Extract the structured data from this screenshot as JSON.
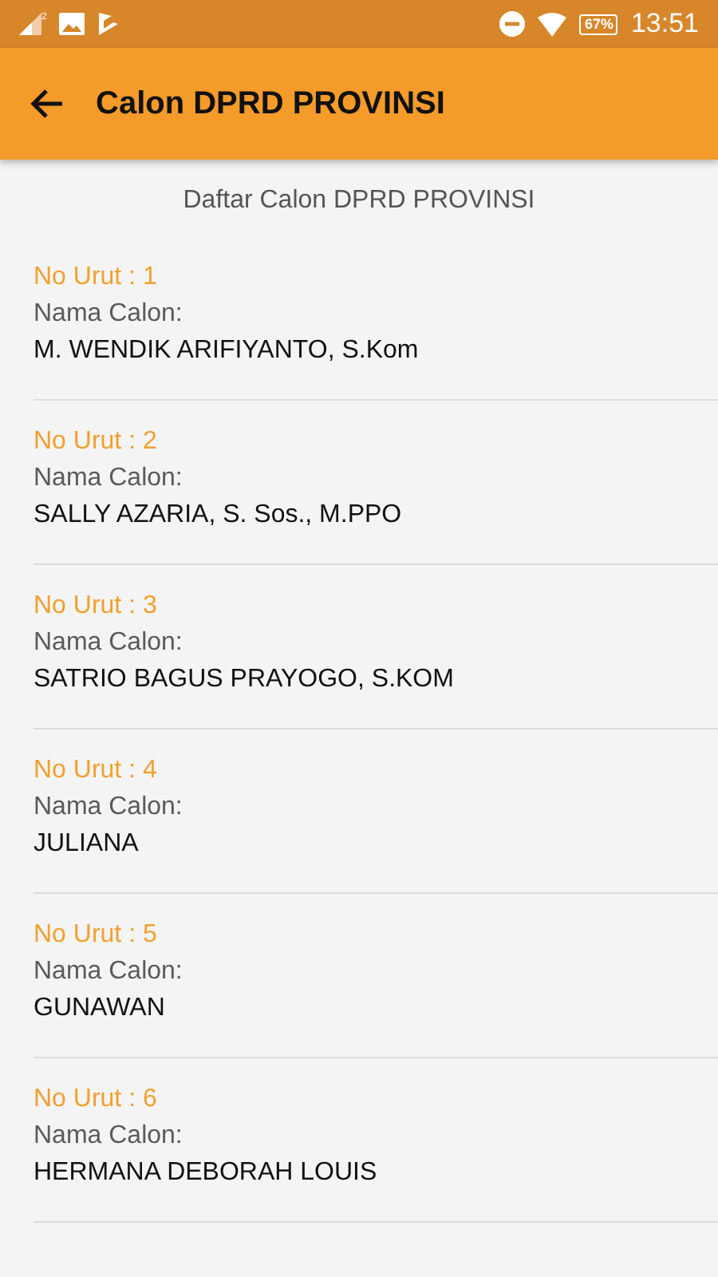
{
  "status_bar": {
    "sim_slot": "2",
    "battery": "67%",
    "time": "13:51"
  },
  "app_bar": {
    "title": "Calon DPRD PROVINSI"
  },
  "list_heading": "Daftar Calon DPRD PROVINSI",
  "candidates": [
    {
      "number": "No Urut : 1",
      "label": "Nama Calon:",
      "name": "M. WENDIK ARIFIYANTO, S.Kom"
    },
    {
      "number": "No Urut : 2",
      "label": "Nama Calon:",
      "name": "SALLY AZARIA, S. Sos., M.PPO"
    },
    {
      "number": "No Urut : 3",
      "label": "Nama Calon:",
      "name": "SATRIO BAGUS PRAYOGO, S.KOM"
    },
    {
      "number": "No Urut : 4",
      "label": "Nama Calon:",
      "name": "JULIANA"
    },
    {
      "number": "No Urut : 5",
      "label": "Nama Calon:",
      "name": "GUNAWAN"
    },
    {
      "number": "No Urut : 6",
      "label": "Nama Calon:",
      "name": "HERMANA DEBORAH LOUIS"
    }
  ]
}
